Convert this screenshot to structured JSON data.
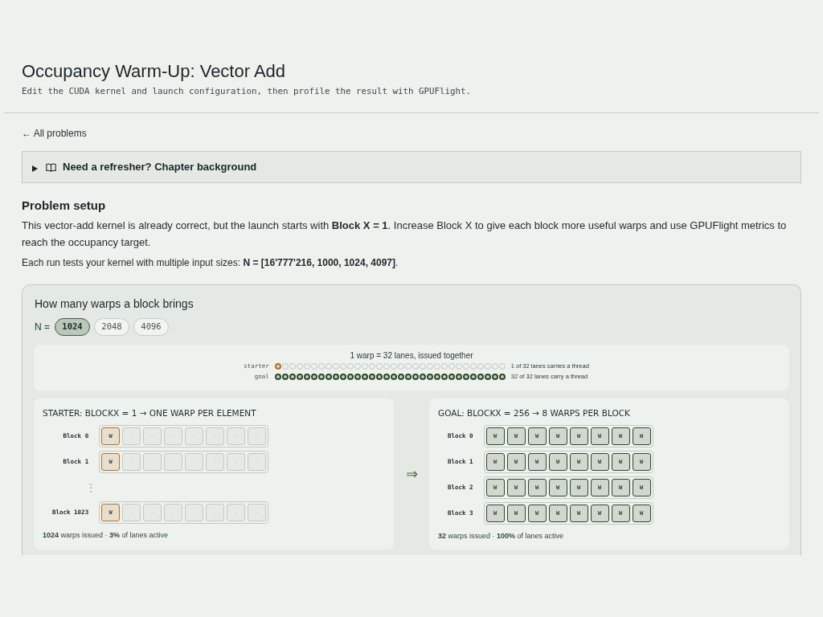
{
  "header": {
    "title": "Occupancy Warm-Up: Vector Add",
    "subtitle": "Edit the CUDA kernel and launch configuration, then profile the result with GPUFlight."
  },
  "back_link": "← All problems",
  "background_panel": {
    "label": "Need a refresher? Chapter background",
    "expanded": false
  },
  "problem_setup": {
    "heading": "Problem setup",
    "description": "This vector-add kernel is already correct, but the launch starts with **Block X = 1**. Increase Block X to give each block more useful warps and use GPUFlight metrics to reach the occupancy target.",
    "note": "Each run tests your kernel with multiple input sizes: **N = [16'777'216, 1000, 1024, 4097]**."
  },
  "warp_explainer": {
    "title": "How many warps a block brings",
    "n_label": "N =",
    "n_options": [
      {
        "label": "1024",
        "selected": true
      },
      {
        "label": "2048",
        "selected": false
      },
      {
        "label": "4096",
        "selected": false
      }
    ],
    "lane_legend": {
      "caption": "1 warp = 32 lanes, issued together",
      "rows": [
        {
          "label": "starter",
          "color": "#b8711f",
          "summary": "1 of 32 lanes carries a thread",
          "lanes": [
            {
              "active": true
            },
            {
              "active": false
            },
            {
              "active": false
            },
            {
              "active": false
            },
            {
              "active": false
            },
            {
              "active": false
            },
            {
              "active": false
            },
            {
              "active": false
            },
            {
              "active": false
            },
            {
              "active": false
            },
            {
              "active": false
            },
            {
              "active": false
            },
            {
              "active": false
            },
            {
              "active": false
            },
            {
              "active": false
            },
            {
              "active": false
            },
            {
              "active": false
            },
            {
              "active": false
            },
            {
              "active": false
            },
            {
              "active": false
            },
            {
              "active": false
            },
            {
              "active": false
            },
            {
              "active": false
            },
            {
              "active": false
            },
            {
              "active": false
            },
            {
              "active": false
            },
            {
              "active": false
            },
            {
              "active": false
            },
            {
              "active": false
            },
            {
              "active": false
            },
            {
              "active": false
            },
            {
              "active": false
            }
          ]
        },
        {
          "label": "goal",
          "color": "#2e4a26",
          "summary": "32 of 32 lanes carry a thread",
          "lanes": [
            {
              "active": true
            },
            {
              "active": true
            },
            {
              "active": true
            },
            {
              "active": true
            },
            {
              "active": true
            },
            {
              "active": true
            },
            {
              "active": true
            },
            {
              "active": true
            },
            {
              "active": true
            },
            {
              "active": true
            },
            {
              "active": true
            },
            {
              "active": true
            },
            {
              "active": true
            },
            {
              "active": true
            },
            {
              "active": true
            },
            {
              "active": true
            },
            {
              "active": true
            },
            {
              "active": true
            },
            {
              "active": true
            },
            {
              "active": true
            },
            {
              "active": true
            },
            {
              "active": true
            },
            {
              "active": true
            },
            {
              "active": true
            },
            {
              "active": true
            },
            {
              "active": true
            },
            {
              "active": true
            },
            {
              "active": true
            },
            {
              "active": true
            },
            {
              "active": true
            },
            {
              "active": true
            },
            {
              "active": true
            }
          ]
        }
      ]
    },
    "panels": [
      {
        "title": "STARTER: BLOCKX = 1 → ONE WARP PER ELEMENT",
        "color": "#b8711f",
        "rows": [
          {
            "kind": "block",
            "label": "Block 0",
            "warps": [
              {
                "label": "W",
                "active": true
              },
              {
                "label": "-",
                "active": false
              },
              {
                "label": "-",
                "active": false
              },
              {
                "label": "-",
                "active": false
              },
              {
                "label": "-",
                "active": false
              },
              {
                "label": "-",
                "active": false
              },
              {
                "label": "-",
                "active": false
              },
              {
                "label": "-",
                "active": false
              }
            ]
          },
          {
            "kind": "block",
            "label": "Block 1",
            "warps": [
              {
                "label": "W",
                "active": true
              },
              {
                "label": "-",
                "active": false
              },
              {
                "label": "-",
                "active": false
              },
              {
                "label": "-",
                "active": false
              },
              {
                "label": "-",
                "active": false
              },
              {
                "label": "-",
                "active": false
              },
              {
                "label": "-",
                "active": false
              },
              {
                "label": "-",
                "active": false
              }
            ]
          },
          {
            "kind": "ellipsis",
            "label": "⋮"
          },
          {
            "kind": "block",
            "label": "Block 1023",
            "warps": [
              {
                "label": "W",
                "active": true
              },
              {
                "label": "-",
                "active": false
              },
              {
                "label": "-",
                "active": false
              },
              {
                "label": "-",
                "active": false
              },
              {
                "label": "-",
                "active": false
              },
              {
                "label": "-",
                "active": false
              },
              {
                "label": "-",
                "active": false
              },
              {
                "label": "-",
                "active": false
              }
            ]
          }
        ],
        "summary": "**1024** warps issued · **3%** of lanes active"
      },
      {
        "title": "GOAL: BLOCKX = 256 → 8 WARPS PER BLOCK",
        "color": "#2e4a26",
        "rows": [
          {
            "kind": "block",
            "label": "Block 0",
            "warps": [
              {
                "label": "W",
                "active": true
              },
              {
                "label": "W",
                "active": true
              },
              {
                "label": "W",
                "active": true
              },
              {
                "label": "W",
                "active": true
              },
              {
                "label": "W",
                "active": true
              },
              {
                "label": "W",
                "active": true
              },
              {
                "label": "W",
                "active": true
              },
              {
                "label": "W",
                "active": true
              }
            ]
          },
          {
            "kind": "block",
            "label": "Block 1",
            "warps": [
              {
                "label": "W",
                "active": true
              },
              {
                "label": "W",
                "active": true
              },
              {
                "label": "W",
                "active": true
              },
              {
                "label": "W",
                "active": true
              },
              {
                "label": "W",
                "active": true
              },
              {
                "label": "W",
                "active": true
              },
              {
                "label": "W",
                "active": true
              },
              {
                "label": "W",
                "active": true
              }
            ]
          },
          {
            "kind": "block",
            "label": "Block 2",
            "warps": [
              {
                "label": "W",
                "active": true
              },
              {
                "label": "W",
                "active": true
              },
              {
                "label": "W",
                "active": true
              },
              {
                "label": "W",
                "active": true
              },
              {
                "label": "W",
                "active": true
              },
              {
                "label": "W",
                "active": true
              },
              {
                "label": "W",
                "active": true
              },
              {
                "label": "W",
                "active": true
              }
            ]
          },
          {
            "kind": "block",
            "label": "Block 3",
            "warps": [
              {
                "label": "W",
                "active": true
              },
              {
                "label": "W",
                "active": true
              },
              {
                "label": "W",
                "active": true
              },
              {
                "label": "W",
                "active": true
              },
              {
                "label": "W",
                "active": true
              },
              {
                "label": "W",
                "active": true
              },
              {
                "label": "W",
                "active": true
              },
              {
                "label": "W",
                "active": true
              }
            ]
          }
        ],
        "summary": "**32** warps issued · **100%** of lanes active"
      }
    ],
    "arrow": "⇒"
  }
}
